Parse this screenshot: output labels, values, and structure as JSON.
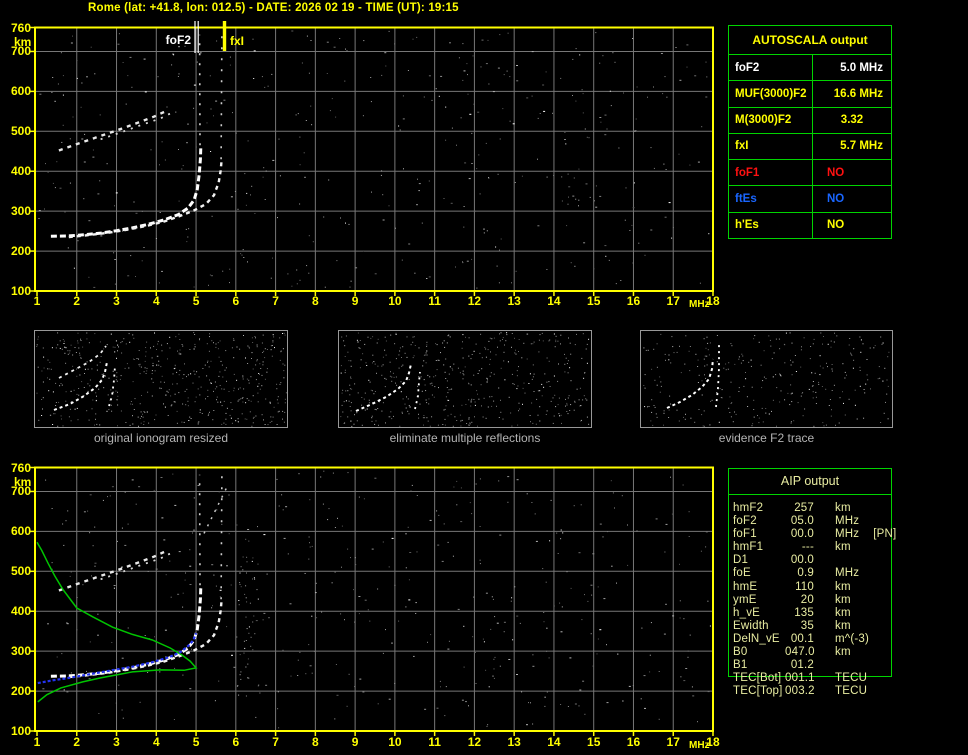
{
  "title": "Rome (lat: +41.8, lon: 012.5) - DATE: 2026 02 19 - TIME (UT): 19:15",
  "colors": {
    "accent_yellow": "#ffff00",
    "plot_border": "#ffff00",
    "grid": "#777777",
    "table_border": "#00d400",
    "aip_text": "#e9eda2",
    "trace_white": "#ffffff",
    "profile_green": "#00c400",
    "restored_blue": "#2433f0",
    "caption_gray": "#b4b4b4",
    "marker_fof2": "#ffffff",
    "marker_fxi": "#ffff00"
  },
  "axes": {
    "x_ticks": [
      "1",
      "2",
      "3",
      "4",
      "5",
      "6",
      "7",
      "8",
      "9",
      "10",
      "11",
      "12",
      "13",
      "14",
      "15",
      "16",
      "17",
      "18"
    ],
    "x_unit": "MHz",
    "y_ticks": [
      "760",
      "700",
      "600",
      "500",
      "400",
      "300",
      "200",
      "100"
    ],
    "y_unit": "km",
    "x_range_mhz": [
      1,
      18
    ],
    "y_range_km": [
      100,
      760
    ]
  },
  "markers": {
    "fof2_label": "foF2",
    "fof2_mhz": 5.0,
    "fxi_label": "fxI",
    "fxi_mhz": 5.7
  },
  "autoscala_table": {
    "header": "AUTOSCALA output",
    "rows": [
      {
        "label": "foF2",
        "value": "5.0 MHz",
        "color": "#ffffff",
        "align": "right"
      },
      {
        "label": "MUF(3000)F2",
        "value": "16.6 MHz",
        "color": "#ffff00",
        "align": "right"
      },
      {
        "label": "M(3000)F2",
        "value": "3.32",
        "color": "#ffff00",
        "align": "center"
      },
      {
        "label": "fxI",
        "value": "5.7 MHz",
        "color": "#ffff00",
        "align": "right"
      },
      {
        "label": "foF1",
        "value": "NO",
        "color": "#ff1111",
        "align": "left"
      },
      {
        "label": "ftEs",
        "value": "NO",
        "color": "#1a66ff",
        "align": "left"
      },
      {
        "label": "h'Es",
        "value": "NO",
        "color": "#ffff00",
        "align": "left"
      }
    ]
  },
  "aip_table": {
    "header": "AIP output",
    "rows": [
      {
        "label": "hmF2",
        "value": "257",
        "unit": "km",
        "note": ""
      },
      {
        "label": "foF2",
        "value": "05.0",
        "unit": "MHz",
        "note": ""
      },
      {
        "label": "foF1",
        "value": "00.0",
        "unit": "MHz",
        "note": "[PN]"
      },
      {
        "label": "hmF1",
        "value": "---",
        "unit": "km",
        "note": ""
      },
      {
        "label": "D1",
        "value": "00.0",
        "unit": "",
        "note": ""
      },
      {
        "label": "foE",
        "value": "0.9",
        "unit": "MHz",
        "note": ""
      },
      {
        "label": "hmE",
        "value": "110",
        "unit": "km",
        "note": ""
      },
      {
        "label": "ymE",
        "value": "20",
        "unit": "km",
        "note": ""
      },
      {
        "label": "h_vE",
        "value": "135",
        "unit": "km",
        "note": ""
      },
      {
        "label": "Ewidth",
        "value": "35",
        "unit": "km",
        "note": ""
      },
      {
        "label": "DelN_vE",
        "value": "00.1",
        "unit": "m^(-3)",
        "note": ""
      },
      {
        "label": "B0",
        "value": "047.0",
        "unit": "km",
        "note": ""
      },
      {
        "label": "B1",
        "value": "01.2",
        "unit": "",
        "note": ""
      },
      {
        "label": "TEC[Bot]",
        "value": "001.1",
        "unit": "TECU",
        "note": ""
      },
      {
        "label": "TEC[Top]",
        "value": "003.2",
        "unit": "TECU",
        "note": ""
      }
    ]
  },
  "panels": [
    {
      "caption": "original ionogram resized"
    },
    {
      "caption": "eliminate multiple reflections"
    },
    {
      "caption": "evidence F2 trace"
    }
  ],
  "traces": {
    "echo_o": [
      [
        1.35,
        237
      ],
      [
        1.8,
        238
      ],
      [
        2.2,
        241
      ],
      [
        2.6,
        245
      ],
      [
        3.0,
        251
      ],
      [
        3.4,
        258
      ],
      [
        3.8,
        267
      ],
      [
        4.2,
        278
      ],
      [
        4.55,
        291
      ],
      [
        4.8,
        308
      ],
      [
        4.95,
        328
      ],
      [
        5.03,
        355
      ],
      [
        5.08,
        392
      ],
      [
        5.11,
        430
      ],
      [
        5.12,
        460
      ]
    ],
    "echo_x": [
      [
        1.8,
        235
      ],
      [
        2.3,
        240
      ],
      [
        2.8,
        246
      ],
      [
        3.3,
        254
      ],
      [
        3.8,
        264
      ],
      [
        4.2,
        274
      ],
      [
        4.6,
        288
      ],
      [
        4.95,
        302
      ],
      [
        5.25,
        318
      ],
      [
        5.45,
        340
      ],
      [
        5.57,
        372
      ],
      [
        5.62,
        402
      ],
      [
        5.64,
        425
      ]
    ],
    "second_hop": [
      [
        1.55,
        452
      ],
      [
        2.0,
        468
      ],
      [
        2.5,
        485
      ],
      [
        3.0,
        502
      ],
      [
        3.5,
        520
      ],
      [
        3.95,
        537
      ],
      [
        4.3,
        553
      ]
    ],
    "second_hop2": [
      [
        2.6,
        480
      ],
      [
        3.1,
        497
      ],
      [
        3.6,
        515
      ],
      [
        4.1,
        532
      ],
      [
        4.42,
        548
      ]
    ],
    "fof2_tail": [
      [
        5.1,
        465
      ],
      [
        5.09,
        742
      ]
    ],
    "fxi_tail": [
      [
        5.63,
        430
      ],
      [
        5.65,
        745
      ]
    ],
    "diag_tail": [
      [
        5.2,
        595
      ],
      [
        5.5,
        655
      ],
      [
        5.78,
        712
      ]
    ],
    "profile_green": [
      [
        1.0,
        573
      ],
      [
        1.12,
        552
      ],
      [
        1.28,
        520
      ],
      [
        1.45,
        488
      ],
      [
        1.65,
        455
      ],
      [
        1.85,
        428
      ],
      [
        2.0,
        408
      ],
      [
        2.4,
        386
      ],
      [
        2.9,
        360
      ],
      [
        3.4,
        342
      ],
      [
        3.9,
        328
      ],
      [
        4.35,
        308
      ],
      [
        4.65,
        290
      ],
      [
        4.85,
        275
      ],
      [
        5.0,
        258
      ],
      [
        4.7,
        252
      ],
      [
        4.1,
        253
      ],
      [
        3.4,
        248
      ],
      [
        2.6,
        233
      ],
      [
        2.15,
        223
      ],
      [
        1.6,
        208
      ],
      [
        1.25,
        191
      ],
      [
        1.02,
        173
      ]
    ],
    "restored_blue": [
      [
        1.02,
        220
      ],
      [
        1.4,
        227
      ],
      [
        1.75,
        232
      ],
      [
        2.2,
        240
      ],
      [
        2.6,
        247
      ],
      [
        3.0,
        254
      ],
      [
        3.4,
        261
      ],
      [
        3.85,
        271
      ],
      [
        4.3,
        284
      ],
      [
        4.6,
        297
      ],
      [
        4.8,
        313
      ],
      [
        4.93,
        327
      ],
      [
        5.0,
        345
      ]
    ]
  },
  "panel_traces": [
    [
      {
        "pts": [
          [
            20,
            80
          ],
          [
            36,
            74
          ],
          [
            50,
            66
          ],
          [
            61,
            58
          ],
          [
            68,
            50
          ],
          [
            71,
            42
          ],
          [
            73,
            32
          ]
        ],
        "kind": "main"
      },
      {
        "pts": [
          [
            25,
            48
          ],
          [
            40,
            40
          ],
          [
            55,
            32
          ],
          [
            66,
            24
          ],
          [
            72,
            16
          ]
        ],
        "kind": "hop"
      },
      {
        "pts": [
          [
            75,
            76
          ],
          [
            78,
            66
          ],
          [
            80,
            50
          ],
          [
            81,
            36
          ]
        ],
        "kind": "curl"
      }
    ],
    [
      {
        "pts": [
          [
            18,
            81
          ],
          [
            34,
            74
          ],
          [
            48,
            67
          ],
          [
            60,
            59
          ],
          [
            68,
            51
          ],
          [
            71,
            43
          ],
          [
            73,
            34
          ]
        ],
        "kind": "main"
      },
      {
        "pts": [
          [
            77,
            79
          ],
          [
            80,
            66
          ],
          [
            81,
            52
          ],
          [
            82,
            42
          ]
        ],
        "kind": "curl"
      }
    ],
    [
      {
        "pts": [
          [
            27,
            78
          ],
          [
            40,
            72
          ],
          [
            52,
            65
          ],
          [
            62,
            57
          ],
          [
            69,
            49
          ],
          [
            72,
            39
          ],
          [
            73,
            29
          ]
        ],
        "kind": "main"
      },
      {
        "pts": [
          [
            76,
            77
          ],
          [
            78,
            58
          ],
          [
            79,
            38
          ],
          [
            79,
            12
          ]
        ],
        "kind": "curl"
      }
    ]
  ]
}
